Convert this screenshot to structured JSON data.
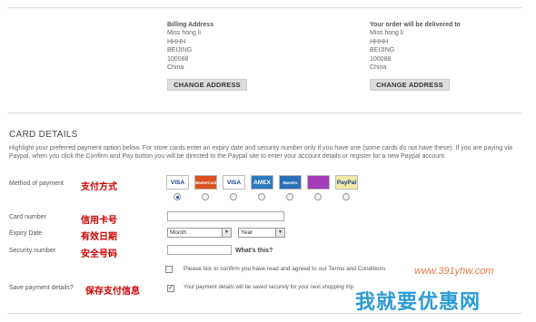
{
  "billing": {
    "title": "Billing Address",
    "lines": [
      "Miss hong  li",
      "HHHH",
      "BEIJING",
      "100088",
      "China"
    ],
    "button": "CHANGE ADDRESS"
  },
  "delivery": {
    "title": "Your order will be delivered to",
    "lines": [
      "Miss hong  li",
      "HHHH",
      "BEIJING",
      "100088",
      "China"
    ],
    "button": "CHANGE ADDRESS"
  },
  "card_details": {
    "title": "CARD DETAILS",
    "intro": "Highlight your preferred payment option below. For store cards enter an expiry date and security number only if you have one (some cards do not have these). If you are paying via Paypal, when you click the Confirm and Pay button you will be directed to the Paypal site to enter your account details or register for a new Paypal account.",
    "method_label": "Method of payment",
    "method_label_zh": "支付方式",
    "cards": [
      {
        "name": "VISA",
        "color": "#1a3f8a",
        "bg": "#ffffff",
        "selected": true
      },
      {
        "name": "MasterCard",
        "color": "#ffffff",
        "bg": "#d9501e",
        "selected": false
      },
      {
        "name": "VISA",
        "color": "#1a3f8a",
        "bg": "#ffffff",
        "selected": false
      },
      {
        "name": "AMEX",
        "color": "#ffffff",
        "bg": "#2b7bc0",
        "selected": false
      },
      {
        "name": "Maestro",
        "color": "#ffffff",
        "bg": "#2d6fb7",
        "selected": false
      },
      {
        "name": "",
        "color": "#ffffff",
        "bg": "#a23cb8",
        "selected": false
      },
      {
        "name": "PayPal",
        "color": "#1a3f8a",
        "bg": "#f1e8a8",
        "selected": false
      }
    ],
    "card_number_label": "Card number",
    "card_number_label_zh": "信用卡号",
    "card_number_value": "",
    "expiry_label": "Expiry Date",
    "expiry_label_zh": "有效日期",
    "expiry_month": "Month",
    "expiry_year": "Year",
    "security_label": "Security number",
    "security_label_zh": "安全号码",
    "security_value": "",
    "whats_this": "What's this?",
    "terms_text": "Please tick to confirm you have read and agreed to our Terms and Conditions",
    "terms_checked": false,
    "save_label": "Save payment details?",
    "save_label_zh": "保存支付信息",
    "save_text": "Your payment details will be saved securely for your next shopping trip",
    "save_checked": true
  },
  "watermark": {
    "sub": "www.391yhw.com",
    "main": "我就要优惠网"
  }
}
